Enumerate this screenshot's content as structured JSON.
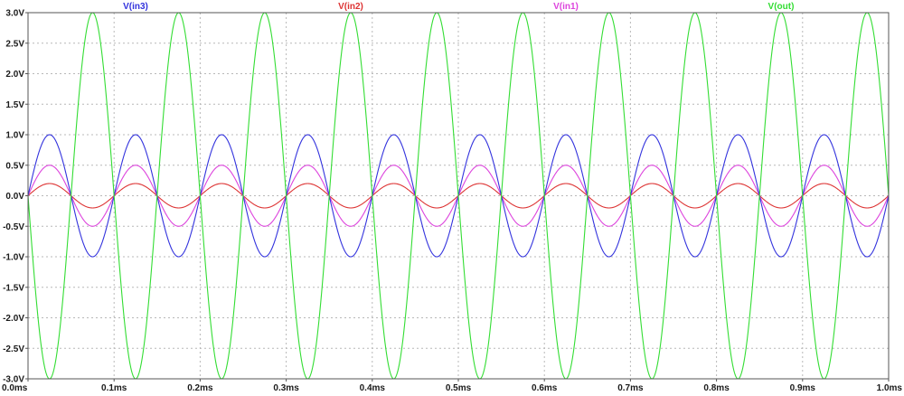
{
  "chart_data": {
    "type": "line",
    "x_range": [
      0.0,
      1.0
    ],
    "x_unit": "ms",
    "ylim": [
      -3.0,
      3.0
    ],
    "grid": true,
    "legend_placement": "top",
    "x_ticks": [
      "0.0ms",
      "0.1ms",
      "0.2ms",
      "0.3ms",
      "0.4ms",
      "0.5ms",
      "0.6ms",
      "0.7ms",
      "0.8ms",
      "0.9ms",
      "1.0ms"
    ],
    "x_tick_values": [
      0.0,
      0.1,
      0.2,
      0.3,
      0.4,
      0.5,
      0.6,
      0.7,
      0.8,
      0.9,
      1.0
    ],
    "y_ticks": [
      "3.0V",
      "2.5V",
      "2.0V",
      "1.5V",
      "1.0V",
      "0.5V",
      "0.0V",
      "-0.5V",
      "-1.0V",
      "-1.5V",
      "-2.0V",
      "-2.5V",
      "-3.0V"
    ],
    "y_tick_values": [
      3.0,
      2.5,
      2.0,
      1.5,
      1.0,
      0.5,
      0.0,
      -0.5,
      -1.0,
      -1.5,
      -2.0,
      -2.5,
      -3.0
    ],
    "series": [
      {
        "name": "V(in3)",
        "color": "#3333dd",
        "amplitude": 1.0,
        "frequency_khz": 10,
        "phase": "sine"
      },
      {
        "name": "V(in2)",
        "color": "#dd3333",
        "amplitude": 0.2,
        "frequency_khz": 10,
        "phase": "sine"
      },
      {
        "name": "V(in1)",
        "color": "#dd44dd",
        "amplitude": 0.5,
        "frequency_khz": 10,
        "phase": "sine"
      },
      {
        "name": "V(out)",
        "color": "#33dd33",
        "amplitude": 3.0,
        "frequency_khz": 10,
        "phase": "inverted-sine"
      }
    ]
  }
}
